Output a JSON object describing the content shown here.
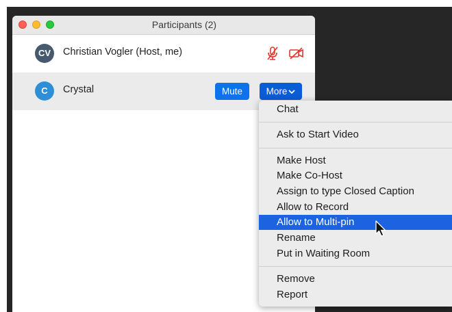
{
  "window": {
    "title": "Participants (2)"
  },
  "participants": [
    {
      "initials": "CV",
      "name": "Christian Vogler (Host, me)",
      "avatar_color": "#47596e",
      "status_icons": [
        "microphone-muted-icon",
        "video-off-icon"
      ],
      "status_color": "#e0362c"
    },
    {
      "initials": "C",
      "name": "Crystal",
      "avatar_color": "#2f8fd6",
      "mute_label": "Mute",
      "more_label": "More"
    }
  ],
  "menu": {
    "items": [
      {
        "label": "Chat"
      },
      {
        "label": "Ask to Start Video"
      },
      {
        "label": "Make Host"
      },
      {
        "label": "Make Co-Host"
      },
      {
        "label": "Assign to type Closed Caption"
      },
      {
        "label": "Allow to Record"
      },
      {
        "label": "Allow to Multi-pin",
        "highlighted": true
      },
      {
        "label": "Rename"
      },
      {
        "label": "Put in Waiting Room"
      },
      {
        "label": "Remove"
      },
      {
        "label": "Report"
      }
    ]
  },
  "colors": {
    "accent": "#0e72ed",
    "highlight": "#1d62e0"
  }
}
